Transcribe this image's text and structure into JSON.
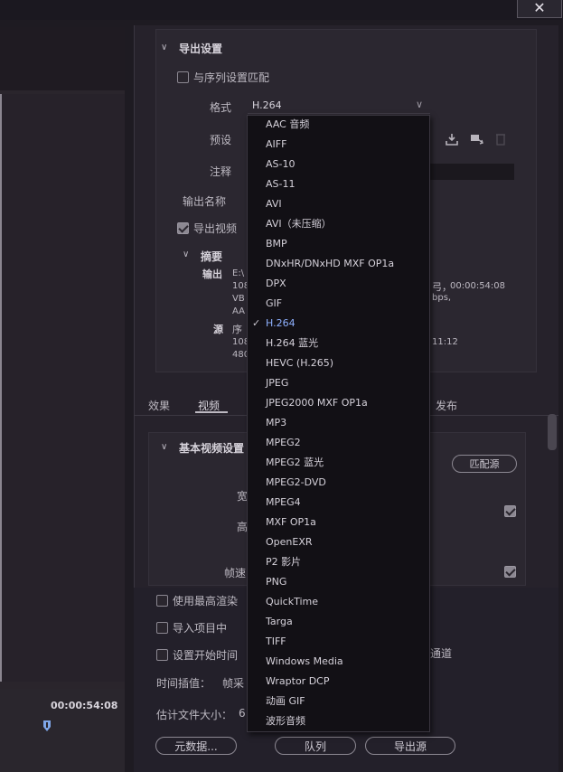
{
  "window": {
    "close_glyph": "✕"
  },
  "left": {
    "timecode": "00:00:54:08"
  },
  "export": {
    "section_title": "导出设置",
    "match_sequence_label": "与序列设置匹配",
    "format_label": "格式",
    "format_value": "H.264",
    "preset_label": "预设",
    "comment_label": "注释",
    "output_name_label": "输出名称",
    "export_video_label": "导出视频",
    "summary_title": "摘要",
    "output_label": "输出",
    "output_lines": [
      "E:\\",
      "108",
      "VB",
      "AA"
    ],
    "output_line2_suffix": "弓，",
    "output_timecode": "00:00:54:08",
    "output_line3_suffix": "bps,",
    "source_label": "源",
    "source_lines": [
      "序",
      "108",
      "480"
    ],
    "source_suffix": "11:12"
  },
  "tabs": {
    "effects": "效果",
    "video": "视频",
    "publish": "发布"
  },
  "video": {
    "section_title": "基本视频设置",
    "match_source_label": "匹配源",
    "width_label_fragment": "宽",
    "height_label_fragment": "高",
    "frame_rate_label_fragment": "帧速"
  },
  "bottom": {
    "max_render_quality": "使用最高渲染",
    "import_into_project": "导入项目中",
    "set_start_timecode": "设置开始时间",
    "alpha_fragment": "通道",
    "time_interpolation_label": "时间插值：",
    "time_interpolation_value": "帧采",
    "estimated_size_label": "估计文件大小：",
    "estimated_size_value": "6",
    "metadata_button": "元数据...",
    "queue_button": "队列",
    "export_button": "导出源"
  },
  "dropdown": {
    "selected": "H.264",
    "check_glyph": "✓",
    "options": [
      "AAC 音频",
      "AIFF",
      "AS-10",
      "AS-11",
      "AVI",
      "AVI（未压缩）",
      "BMP",
      "DNxHR/DNxHD MXF OP1a",
      "DPX",
      "GIF",
      "H.264",
      "H.264 蓝光",
      "HEVC (H.265)",
      "JPEG",
      "JPEG2000 MXF OP1a",
      "MP3",
      "MPEG2",
      "MPEG2 蓝光",
      "MPEG2-DVD",
      "MPEG4",
      "MXF OP1a",
      "OpenEXR",
      "P2 影片",
      "PNG",
      "QuickTime",
      "Targa",
      "TIFF",
      "Windows Media",
      "Wraptor DCP",
      "动画 GIF",
      "波形音频"
    ]
  }
}
